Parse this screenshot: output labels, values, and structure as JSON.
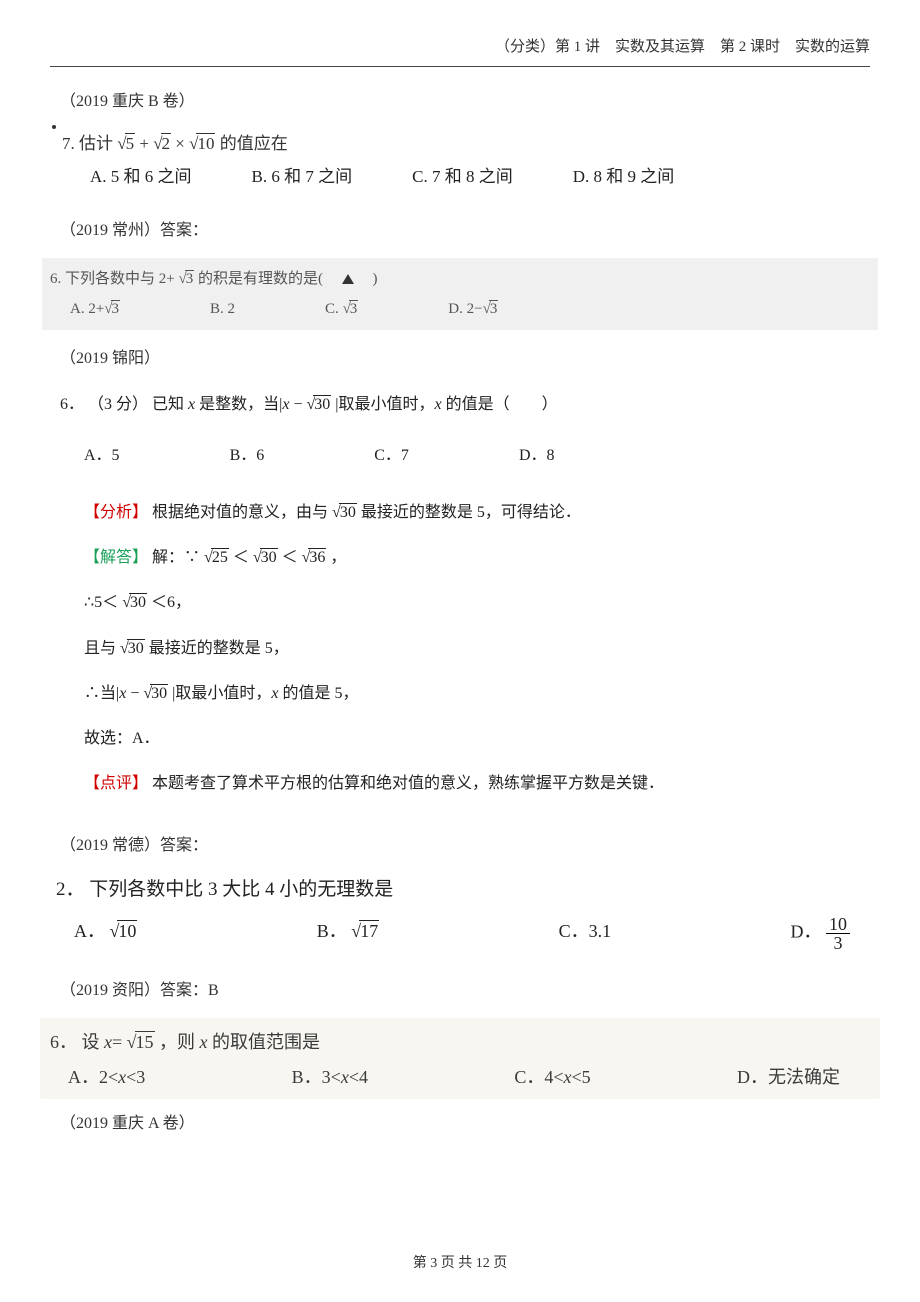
{
  "header": {
    "category": "（分类）第 1 讲",
    "topic": "实数及其运算",
    "lesson": "第 2 课时",
    "subtopic": "实数的运算"
  },
  "sources": {
    "s1": "（2019 重庆 B 卷）",
    "s2": "（2019 常州）答案：",
    "s3": "（2019 锦阳）",
    "s4": "（2019 常德）答案：",
    "s5": "（2019 资阳）答案：B",
    "s6": "（2019 重庆 A 卷）"
  },
  "q7": {
    "num": "7.",
    "stem_prefix": "估计",
    "expr_parts": {
      "r5": "5",
      "r2": "2",
      "r10": "10"
    },
    "stem_suffix": "的值应在",
    "opts": {
      "A": "A. 5 和 6 之间",
      "B": "B. 6 和 7 之间",
      "C": "C. 7 和 8 之间",
      "D": "D. 8 和 9 之间"
    }
  },
  "q6cz": {
    "num": "6.",
    "stem_a": "下列各数中与 2+",
    "r3": "3",
    "stem_b": "的积是有理数的是(　",
    "stem_c": "　)",
    "opts": {
      "A_pref": "A. 2+",
      "B": "B. 2",
      "C_pref": "C. ",
      "D_pref": "D. 2−"
    }
  },
  "q6jy": {
    "num": "6．",
    "points": "（3 分）",
    "stem_a": "已知 x 是整数，当|x − ",
    "r30": "30",
    "stem_b": "|取最小值时，x 的值是（　　）",
    "opts": {
      "A": "A．5",
      "B": "B．6",
      "C": "C．7",
      "D": "D．8"
    },
    "analysis": {
      "fenxi_label": "【分析】",
      "fenxi_text_a": "根据绝对值的意义，由与",
      "fenxi_text_b": "最接近的整数是 5，可得结论．",
      "jieda_label": "【解答】",
      "jieda_prefix": "解：∵",
      "r25": "25",
      "less1": "＜",
      "r30b": "30",
      "less2": "＜",
      "r36": "36",
      "comma": "，",
      "line2_a": "∴5＜",
      "line2_b": "＜6，",
      "line3_a": "且与",
      "line3_b": "最接近的整数是 5，",
      "line4_a": "∴当|x − ",
      "line4_b": "|取最小值时，x 的值是 5，",
      "conclusion": "故选：A．",
      "dianping_label": "【点评】",
      "dianping_text": "本题考查了算术平方根的估算和绝对值的意义，熟练掌握平方数是关键．"
    }
  },
  "q2cd": {
    "num": "2．",
    "stem": "下列各数中比 3 大比 4 小的无理数是",
    "opts": {
      "A_pref": "A．",
      "A_rad": "10",
      "B_pref": "B．",
      "B_rad": "17",
      "C": "C．3.1",
      "D_pref": "D．",
      "D_num": "10",
      "D_den": "3"
    }
  },
  "q6zy": {
    "num": "6．",
    "stem_a": "设 x=",
    "r15": "15",
    "stem_b": "，则 x 的取值范围是",
    "opts": {
      "A": "A．2<x<3",
      "B": "B．3<x<4",
      "C": "C．4<x<5",
      "D": "D．无法确定"
    }
  },
  "footer": {
    "text": "第 3 页 共 12 页"
  }
}
